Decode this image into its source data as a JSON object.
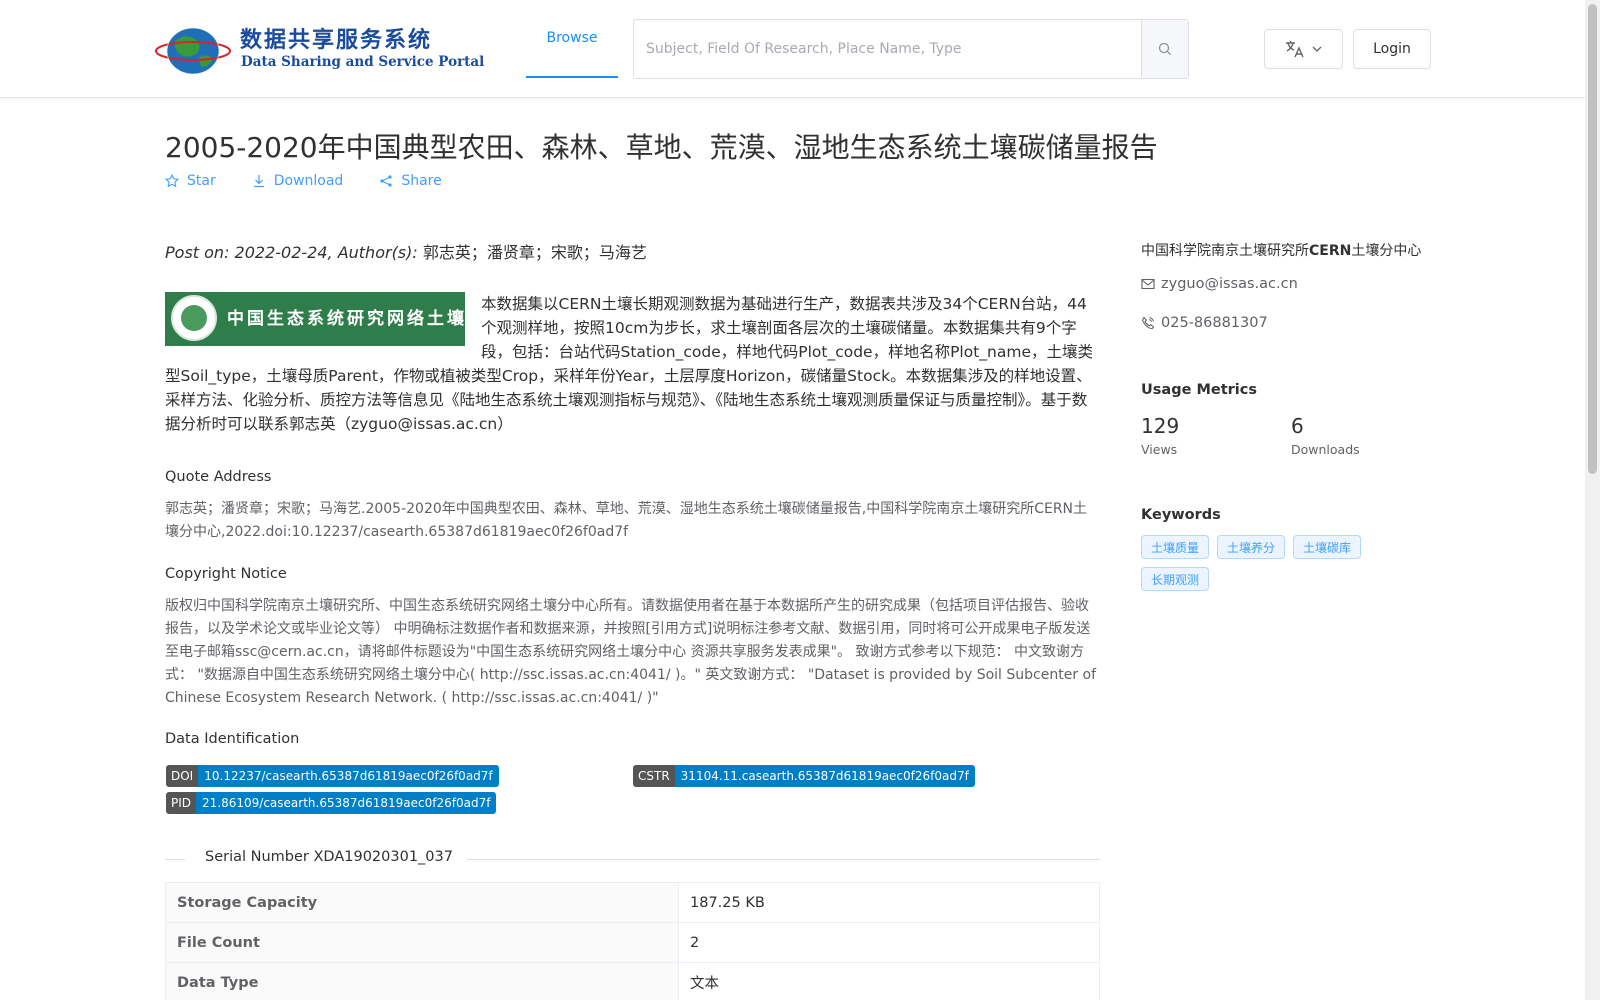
{
  "header": {
    "logo_cn": "数据共享服务系统",
    "logo_en": "Data Sharing and Service Portal",
    "nav_browse": "Browse",
    "search_placeholder": "Subject, Field Of Research, Place Name, Type",
    "login": "Login",
    "icons": {
      "search": "search-icon",
      "language": "translate-icon",
      "dropdown": "chevron-down-icon"
    }
  },
  "dataset": {
    "title": "2005-2020年中国典型农田、森林、草地、荒漠、湿地生态系统土壤碳储量报告",
    "actions": {
      "star": "Star",
      "download": "Download",
      "share": "Share"
    },
    "post_prefix": "Post on: 2022-02-24, Author(s): ",
    "authors": "郭志英；潘贤章；宋歌；马海艺",
    "banner_text": "中国生态系统研究网络土壤分中心",
    "description": "本数据集以CERN土壤长期观测数据为基础进行生产，数据表共涉及34个CERN台站，44个观测样地，按照10cm为步长，求土壤剖面各层次的土壤碳储量。本数据集共有9个字段，包括：台站代码Station_code，样地代码Plot_code，样地名称Plot_name，土壤类型Soil_type，土壤母质Parent，作物或植被类型Crop，采样年份Year，土层厚度Horizon，碳储量Stock。本数据集涉及的样地设置、采样方法、化验分析、质控方法等信息见《陆地生态系统土壤观测指标与规范》、《陆地生态系统土壤观测质量保证与质量控制》。基于数据分析时可以联系郭志英（zyguo@issas.ac.cn）",
    "quote_heading": "Quote Address",
    "quote_text": "郭志英；潘贤章；宋歌；马海艺.2005-2020年中国典型农田、森林、草地、荒漠、湿地生态系统土壤碳储量报告,中国科学院南京土壤研究所CERN土壤分中心,2022.doi:10.12237/casearth.65387d61819aec0f26f0ad7f",
    "copyright_heading": "Copyright Notice",
    "copyright_text": "版权归中国科学院南京土壤研究所、中国生态系统研究网络土壤分中心所有。请数据使用者在基于本数据所产生的研究成果（包括项目评估报告、验收报告，以及学术论文或毕业论文等） 中明确标注数据作者和数据来源，并按照[引用方式]说明标注参考文献、数据引用，同时将可公开成果电子版发送至电子邮箱ssc@cern.ac.cn，请将邮件标题设为\"中国生态系统研究网络土壤分中心 资源共享服务发表成果\"。 致谢方式参考以下规范： 中文致谢方式： \"数据源自中国生态系统研究网络土壤分中心( http://ssc.issas.ac.cn:4041/ )。\" 英文致谢方式： \"Dataset is provided by Soil Subcenter of Chinese Ecosystem Research Network. ( http://ssc.issas.ac.cn:4041/ )\"",
    "ident_heading": "Data Identification",
    "doi_label": "DOI",
    "doi_value": "10.12237/casearth.65387d61819aec0f26f0ad7f",
    "cstr_label": "CSTR",
    "cstr_value": "31104.11.casearth.65387d61819aec0f26f0ad7f",
    "pid_label": "PID",
    "pid_value": "21.86109/casearth.65387d61819aec0f26f0ad7f",
    "serial": "Serial Number XDA19020301_037",
    "table": [
      {
        "key": "Storage Capacity",
        "value": "187.25 KB"
      },
      {
        "key": "File Count",
        "value": "2"
      },
      {
        "key": "Data Type",
        "value": "文本"
      }
    ]
  },
  "sidebar": {
    "org_prefix": "中国科学院南京土壤研究所",
    "org_bold": "CERN",
    "org_suffix": "土壤分中心",
    "email": "zyguo@issas.ac.cn",
    "phone": "025-86881307",
    "metrics_heading": "Usage Metrics",
    "views_num": "129",
    "views_label": "Views",
    "downloads_num": "6",
    "downloads_label": "Downloads",
    "keywords_heading": "Keywords",
    "keywords": [
      "土壤质量",
      "土壤养分",
      "土壤碳库",
      "长期观测"
    ]
  },
  "colors": {
    "accent": "#409eff",
    "doi_blue": "#007ec6",
    "badge_gray": "#555555",
    "logo_blue": "#1a4b9c"
  }
}
